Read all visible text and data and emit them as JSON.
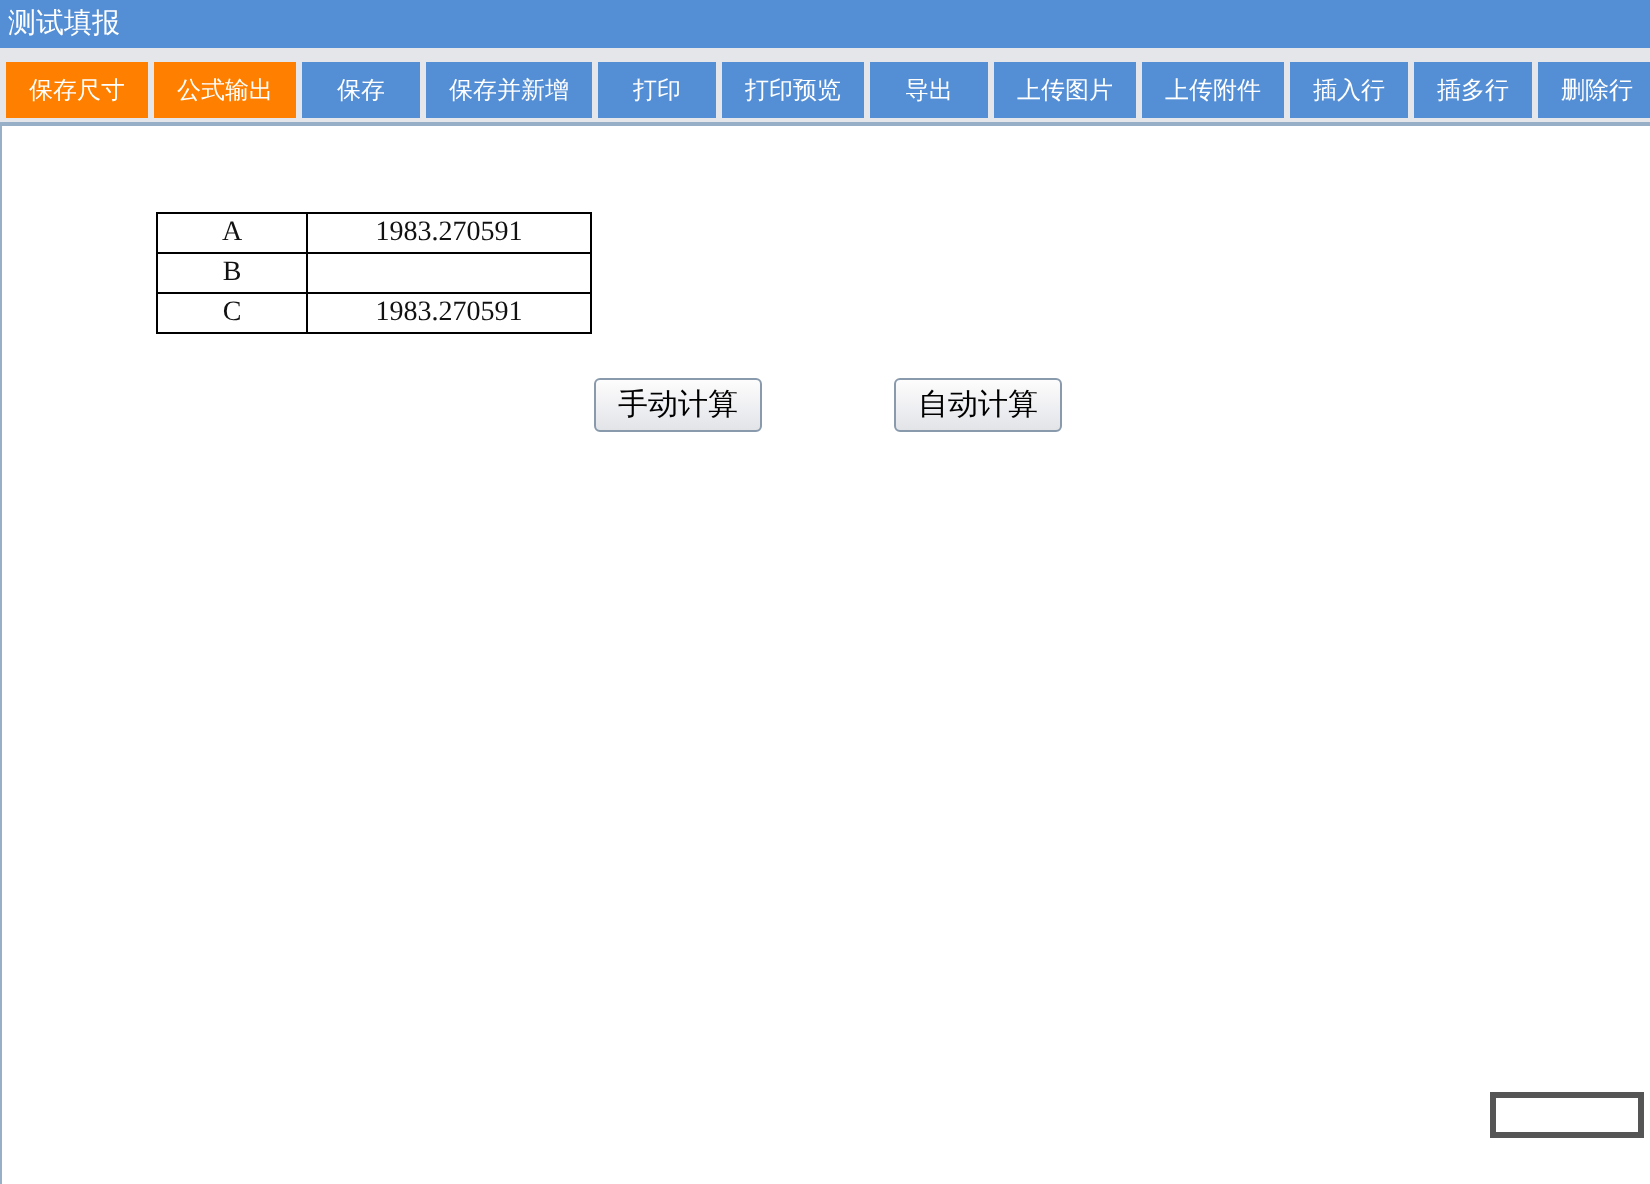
{
  "window": {
    "title": "测试填报"
  },
  "toolbar": [
    {
      "label": "保存尺寸",
      "color": "#ff8000"
    },
    {
      "label": "公式输出",
      "color": "#ff8000"
    },
    {
      "label": "保存",
      "color": "#548fd6"
    },
    {
      "label": "保存并新增",
      "color": "#548fd6"
    },
    {
      "label": "打印",
      "color": "#548fd6"
    },
    {
      "label": "打印预览",
      "color": "#548fd6"
    },
    {
      "label": "导出",
      "color": "#548fd6"
    },
    {
      "label": "上传图片",
      "color": "#548fd6"
    },
    {
      "label": "上传附件",
      "color": "#548fd6"
    },
    {
      "label": "插入行",
      "color": "#548fd6"
    },
    {
      "label": "插多行",
      "color": "#548fd6"
    },
    {
      "label": "删除行",
      "color": "#548fd6"
    }
  ],
  "table": {
    "rows": [
      {
        "name": "A",
        "value": "1983.270591"
      },
      {
        "name": "B"
      },
      {
        "name": "C",
        "value": "1983.270591"
      }
    ]
  },
  "buttons": [
    "手动计算",
    "自动计算"
  ]
}
